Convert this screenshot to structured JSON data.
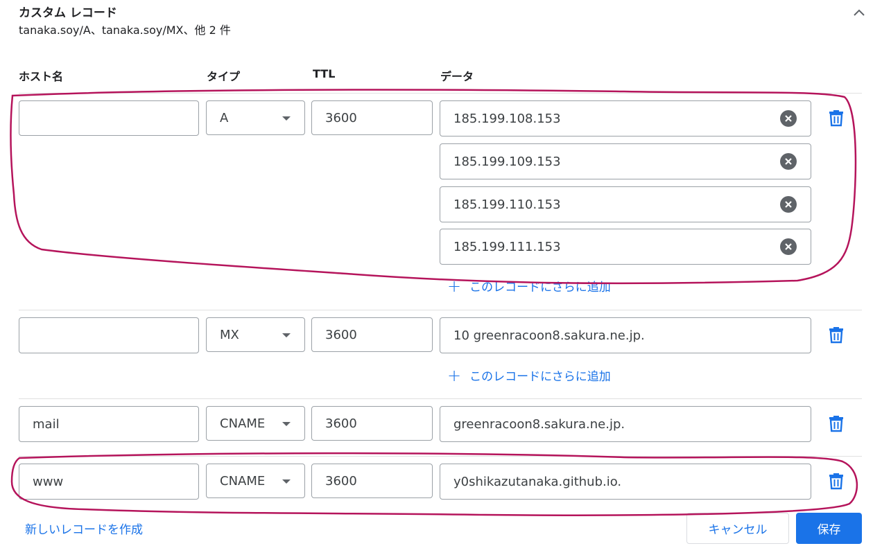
{
  "header": {
    "title": "カスタム レコード",
    "subtitle": "tanaka.soy/A、tanaka.soy/MX、他 2 件"
  },
  "columns": {
    "host": "ホスト名",
    "type": "タイプ",
    "ttl": "TTL",
    "data": "データ"
  },
  "records": [
    {
      "host": "",
      "type": "A",
      "ttl": "3600",
      "data": [
        "185.199.108.153",
        "185.199.109.153",
        "185.199.110.153",
        "185.199.111.153"
      ],
      "add_label": "このレコードにさらに追加"
    },
    {
      "host": "",
      "type": "MX",
      "ttl": "3600",
      "data": [
        "10 greenracoon8.sakura.ne.jp."
      ],
      "add_label": "このレコードにさらに追加"
    },
    {
      "host": "mail",
      "type": "CNAME",
      "ttl": "3600",
      "data": [
        "greenracoon8.sakura.ne.jp."
      ]
    },
    {
      "host": "www",
      "type": "CNAME",
      "ttl": "3600",
      "data": [
        "y0shikazutanaka.github.io."
      ]
    }
  ],
  "footer": {
    "new_record": "新しいレコードを作成",
    "cancel": "キャンセル",
    "save": "保存"
  },
  "colors": {
    "accent": "#1a73e8",
    "annotation": "#b5145b",
    "icon": "#5f6368"
  }
}
